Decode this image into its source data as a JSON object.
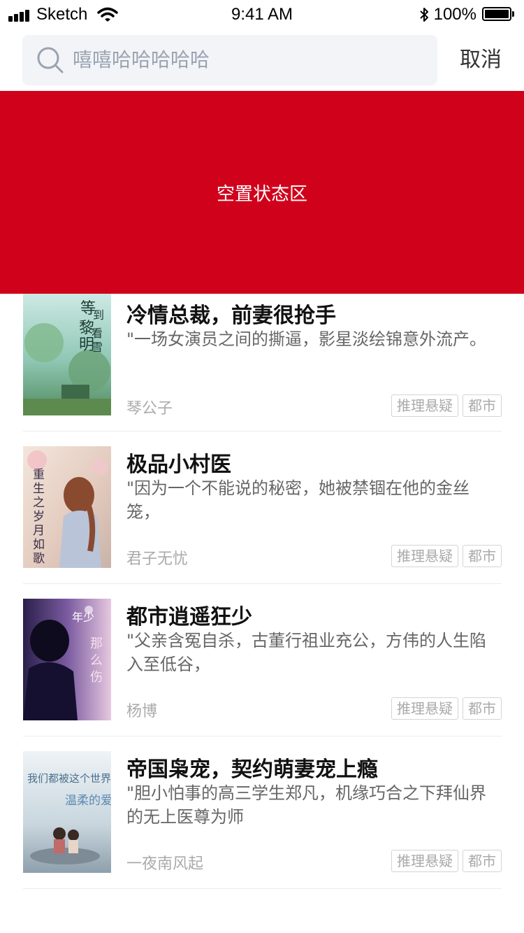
{
  "status_bar": {
    "carrier": "Sketch",
    "time": "9:41 AM",
    "battery": "100%"
  },
  "search": {
    "query": "嘻嘻哈哈哈哈哈",
    "cancel_label": "取消"
  },
  "empty_state": {
    "label": "空置状态区",
    "background": "#d0021b"
  },
  "books": [
    {
      "title": "冷情总裁，前妻很抢手",
      "description": "\"一场女演员之间的撕逼，影星淡绘锦意外流产。",
      "author": "琴公子",
      "tags": [
        "推理悬疑",
        "都市"
      ]
    },
    {
      "title": "极品小村医",
      "description": "\"因为一个不能说的秘密，她被禁锢在他的金丝笼，",
      "author": "君子无忧",
      "tags": [
        "推理悬疑",
        "都市"
      ]
    },
    {
      "title": "都市逍遥狂少",
      "description": "\"父亲含冤自杀，古董行祖业充公，方伟的人生陷入至低谷，",
      "author": "杨博",
      "tags": [
        "推理悬疑",
        "都市"
      ]
    },
    {
      "title": "帝国枭宠，契约萌妻宠上瘾",
      "description": "\"胆小怕事的高三学生郑凡，机缘巧合之下拜仙界的无上医尊为师",
      "author": "一夜南风起",
      "tags": [
        "推理悬疑",
        "都市"
      ]
    }
  ]
}
